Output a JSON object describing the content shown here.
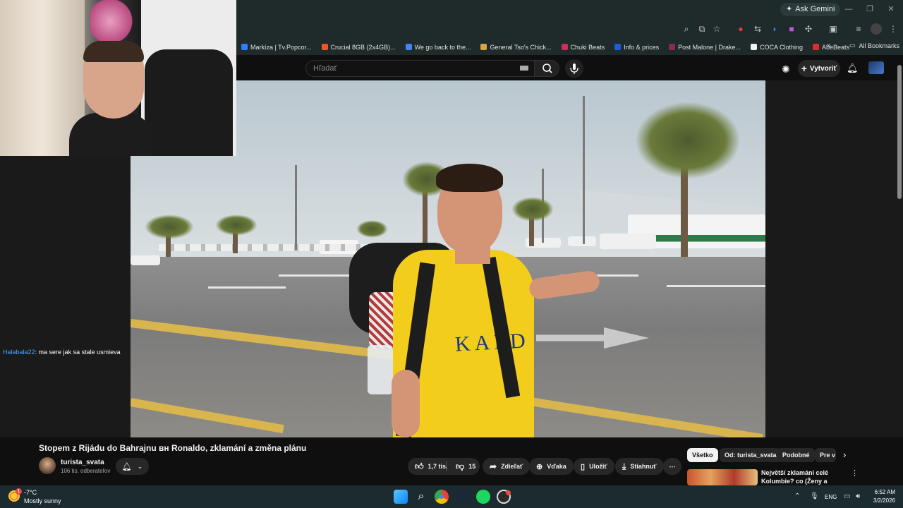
{
  "browser": {
    "ask_gemini": "Ask Gemini",
    "bookmarks": [
      {
        "label": "Markíza | Tv.Popcor...",
        "color": "#2d7ff9"
      },
      {
        "label": "Crucial 8GB (2x4GB)...",
        "color": "#e8562a"
      },
      {
        "label": "We go back to the...",
        "color": "#4285f4"
      },
      {
        "label": "General Tso's Chick...",
        "color": "#d6a24a"
      },
      {
        "label": "Chuki Beats",
        "color": "#c8325a"
      },
      {
        "label": "Info & prices",
        "color": "#1e5bd6"
      },
      {
        "label": "Post Malone | Drake...",
        "color": "#8a2a5a"
      },
      {
        "label": "COCA Clothing",
        "color": "#111111"
      },
      {
        "label": "AbeBeats",
        "color": "#e02b2b"
      }
    ],
    "all_bookmarks": "All Bookmarks"
  },
  "youtube": {
    "search_placeholder": "Hľadať",
    "create_label": "Vytvoriť"
  },
  "chat": {
    "username": "Halabala22",
    "message": ": ma sere jak sa stale usmieva"
  },
  "video": {
    "title": "Stopem z Rijádu do Bahrajnu ʙʜ Ronaldo, zklamání a změna plánu",
    "channel_name": "turista_svata",
    "subscribers": "106 tis. odberateľov",
    "shirt_text": "KAFD",
    "likes": "1,7 tis.",
    "dislikes": "15",
    "share_label": "Zdieľať",
    "thanks_label": "Vďaka",
    "save_label": "Uložiť",
    "download_label": "Stiahnuť",
    "more_label": "⋯"
  },
  "chips": [
    {
      "label": "Všetko",
      "active": true
    },
    {
      "label": "Od: turista_svata",
      "active": false
    },
    {
      "label": "Podobné",
      "active": false
    },
    {
      "label": "Pre v",
      "active": false
    }
  ],
  "recommendation": {
    "title": "Největší zklamání celé Kolumbie? co (Ženy a Krádeže)"
  },
  "taskbar": {
    "temp": "-7°C",
    "weather": "Mostly sunny",
    "weather_badge": "1",
    "lang": "ENG",
    "time": "6:52 AM",
    "date": "3/2/2026"
  }
}
